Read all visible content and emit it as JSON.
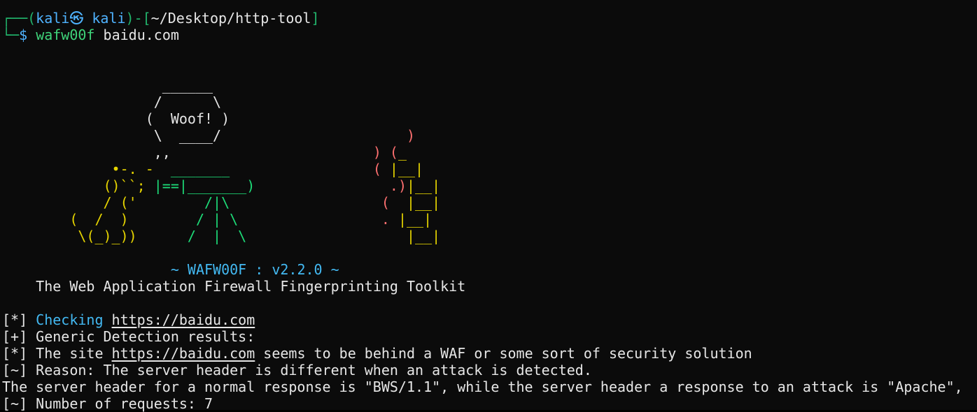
{
  "prompt": {
    "frame_top_left": "┌──(",
    "user_host": "kali㉿ kali",
    "frame_mid": ")-[",
    "path": "~/Desktop/http-tool",
    "frame_close": "]",
    "frame_bottom": "└─",
    "dollar": "$ ",
    "command": "wafw00f",
    "argument": " baidu.com"
  },
  "banner": {
    "lines": [
      [
        {
          "t": "                   ______",
          "c": "white"
        }
      ],
      [
        {
          "t": "                  /      \\",
          "c": "white"
        }
      ],
      [
        {
          "t": "                 (  Woof! )",
          "c": "white"
        }
      ],
      [
        {
          "t": "                  \\  ____/",
          "c": "white"
        },
        {
          "t": "                      )",
          "c": "red"
        }
      ],
      [
        {
          "t": "                  ,,",
          "c": "white"
        },
        {
          "t": "                        ) (",
          "c": "red"
        },
        {
          "t": "_",
          "c": "yellow"
        }
      ],
      [
        {
          "t": "             •-. -",
          "c": "yellow"
        },
        {
          "t": "  _______",
          "c": "green"
        },
        {
          "t": "                 ( ",
          "c": "red"
        },
        {
          "t": "|__|",
          "c": "yellow"
        }
      ],
      [
        {
          "t": "            ()``; ",
          "c": "yellow"
        },
        {
          "t": "|==|_______)",
          "c": "green"
        },
        {
          "t": "                .)",
          "c": "red"
        },
        {
          "t": "|__|",
          "c": "yellow"
        }
      ],
      [
        {
          "t": "            / ('",
          "c": "yellow"
        },
        {
          "t": "        /|\\",
          "c": "green"
        },
        {
          "t": "                  ( ",
          "c": "red"
        },
        {
          "t": " |__|",
          "c": "yellow"
        }
      ],
      [
        {
          "t": "        (  /  )",
          "c": "yellow"
        },
        {
          "t": "        / | \\",
          "c": "green"
        },
        {
          "t": "                 . ",
          "c": "red"
        },
        {
          "t": "|__|",
          "c": "yellow"
        }
      ],
      [
        {
          "t": "         \\(_)_))",
          "c": "yellow"
        },
        {
          "t": "      /  |  \\",
          "c": "green"
        },
        {
          "t": "                   ",
          "c": "white"
        },
        {
          "t": "|__|",
          "c": "yellow"
        }
      ]
    ],
    "version_text": "~ WAFW00F : v2.2.0 ~",
    "tagline": "The Web Application Firewall Fingerprinting Toolkit"
  },
  "output": {
    "checking_prefix": "[*] ",
    "checking_label": "Checking",
    "checking_url": "https://baidu.com",
    "generic_line": "[+] Generic Detection results:",
    "site_prefix": "[*] The site ",
    "site_url": "https://baidu.com",
    "site_suffix": " seems to be behind a WAF or some sort of security solution",
    "reason_line": "[~] Reason: The server header is different when an attack is detected.",
    "server_line": "The server header for a normal response is \"BWS/1.1\", while the server header a response to an attack is \"Apache\",",
    "requests_line": "[~] Number of requests: 7"
  },
  "colors": {
    "background": "#0b0b0b",
    "text": "#e6e6e6",
    "prompt_frame": "#21b36b",
    "prompt_user": "#4fb3ff",
    "command": "#3fd47a",
    "ascii_yellow": "#e6d400",
    "ascii_green": "#1ddc78",
    "ascii_red": "#ff7070",
    "version_cyan": "#43b9f2"
  }
}
